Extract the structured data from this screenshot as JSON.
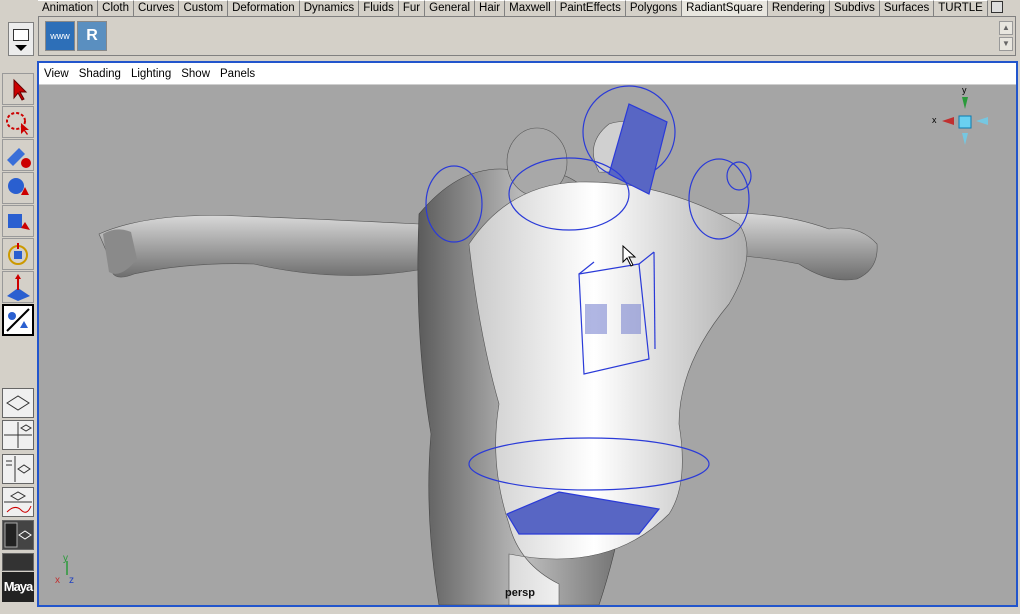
{
  "shelf": {
    "tabs": [
      "Animation",
      "Cloth",
      "Curves",
      "Custom",
      "Deformation",
      "Dynamics",
      "Fluids",
      "Fur",
      "General",
      "Hair",
      "Maxwell",
      "PaintEffects",
      "Polygons",
      "RadiantSquare",
      "Rendering",
      "Subdivs",
      "Surfaces",
      "TURTLE"
    ],
    "active_tab": "RadiantSquare",
    "buttons": [
      {
        "name": "www-icon",
        "label": "www"
      },
      {
        "name": "radiantsquare-icon",
        "label": "R"
      }
    ]
  },
  "viewport": {
    "menu": [
      "View",
      "Shading",
      "Lighting",
      "Show",
      "Panels"
    ],
    "camera_label": "persp",
    "axis": {
      "y": "y",
      "x": "x",
      "z": "z"
    },
    "view_cube": {
      "y": "y",
      "x": "x"
    }
  },
  "toolbox": {
    "tools": [
      "select-tool-icon",
      "lasso-tool-icon",
      "paint-select-tool-icon",
      "move-tool-icon",
      "rotate-tool-icon",
      "scale-tool-icon",
      "manipulator-tool-icon",
      "last-tool-icon"
    ]
  },
  "logo": "Maya",
  "colors": {
    "viewport_bg": "#a5a5a5",
    "selection_blue": "#2a3ad8",
    "panel_border": "#2255cc"
  }
}
